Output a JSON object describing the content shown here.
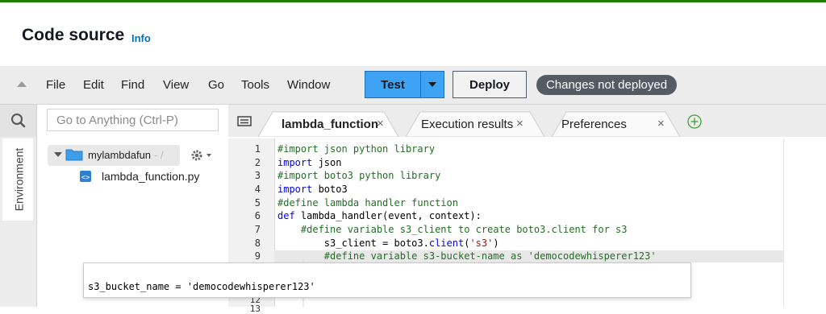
{
  "header": {
    "title": "Code source",
    "info_link": "Info"
  },
  "menubar": {
    "items": [
      "File",
      "Edit",
      "Find",
      "View",
      "Go",
      "Tools",
      "Window"
    ],
    "test_label": "Test",
    "deploy_label": "Deploy",
    "status_badge": "Changes not deployed"
  },
  "sidebar": {
    "search_placeholder": "Go to Anything (Ctrl-P)",
    "env_tab_label": "Environment",
    "folder_name": "mylambdafun",
    "folder_suffix": " - /",
    "file_name": "lambda_function.py"
  },
  "tabs": [
    {
      "label": "lambda_function",
      "close": "×",
      "active": true
    },
    {
      "label": "Execution results",
      "close": "×",
      "active": false
    },
    {
      "label": "Preferences",
      "close": "×",
      "active": false
    }
  ],
  "editor": {
    "line_numbers": [
      "1",
      "2",
      "3",
      "4",
      "5",
      "6",
      "7",
      "8",
      "9",
      "12",
      "13"
    ],
    "lines": [
      "#import json python library",
      "import json",
      "#import boto3 python library",
      "import boto3",
      "#define lambda handler function",
      "def lambda_handler(event, context):",
      "    #define variable s3_client to create boto3.client for s3",
      "        s3_client = boto3.client('s3')",
      "        #define variable s3-bucket-name as 'democodewhisperer123'"
    ],
    "suggestion": "s3_bucket_name = 'democodewhisperer123'"
  },
  "colors": {
    "accent_green": "#1d8102",
    "info_blue": "#0073bb",
    "test_button": "#3ea2f5",
    "badge": "#545b64",
    "comment": "#236e25",
    "keyword": "#0000ff",
    "string": "#a31515"
  },
  "icons": [
    "collapse-triangle-icon",
    "caret-down-icon",
    "search-icon",
    "folder-icon",
    "file-icon",
    "gear-icon",
    "tab-list-icon",
    "close-icon",
    "add-tab-icon"
  ]
}
